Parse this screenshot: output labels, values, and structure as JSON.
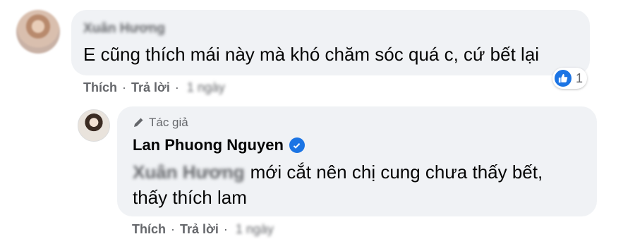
{
  "comment": {
    "author": "Xuân Hương",
    "text": "E cũng thích mái này mà khó chăm sóc quá c, cứ bết lại",
    "reaction_count": "1",
    "actions": {
      "like": "Thích",
      "reply": "Trả lời",
      "time": "1 ngày"
    }
  },
  "reply": {
    "author_tag": "Tác giả",
    "author": "Lan Phuong Nguyen",
    "mention": "Xuân Hương",
    "text_line1": "mới cắt nên chị cung chưa thấy bết,",
    "text_line2": "thấy thích lam",
    "actions": {
      "like": "Thích",
      "reply": "Trả lời",
      "time": "1 ngày"
    }
  },
  "colors": {
    "bubble": "#f0f2f5",
    "secondary_text": "#65676b",
    "accent": "#1b74e4"
  },
  "icons": [
    "like-reaction-icon",
    "pen-icon",
    "verified-badge-icon"
  ]
}
